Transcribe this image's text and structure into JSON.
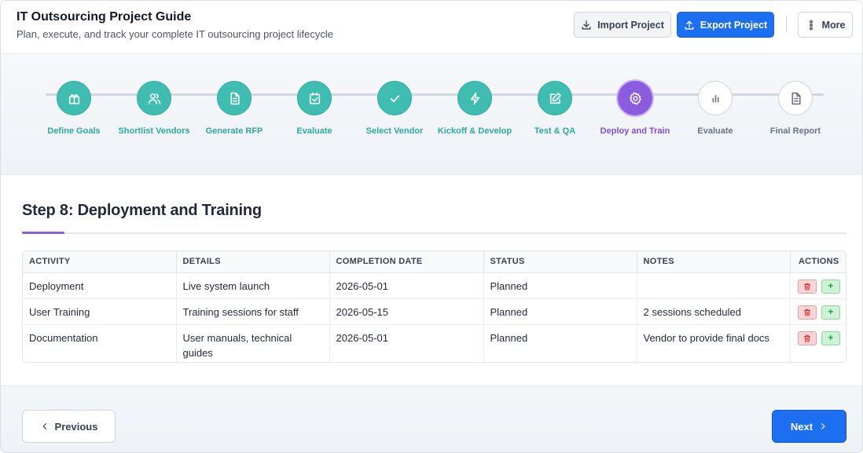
{
  "header": {
    "title": "IT Outsourcing Project Guide",
    "subtitle": "Plan, execute, and track your complete IT outsourcing project lifecycle",
    "import_label": "Import Project",
    "export_label": "Export Project",
    "more_label": "More"
  },
  "stepper": {
    "steps": [
      {
        "label": "Define Goals",
        "state": "done",
        "icon": "gift-icon"
      },
      {
        "label": "Shortlist Vendors",
        "state": "done",
        "icon": "users-icon"
      },
      {
        "label": "Generate RFP",
        "state": "done",
        "icon": "document-icon"
      },
      {
        "label": "Evaluate",
        "state": "done",
        "icon": "clipboard-check-icon"
      },
      {
        "label": "Select Vendor",
        "state": "done",
        "icon": "check-icon"
      },
      {
        "label": "Kickoff & Develop",
        "state": "done",
        "icon": "lightning-icon"
      },
      {
        "label": "Test & QA",
        "state": "done",
        "icon": "edit-icon"
      },
      {
        "label": "Deploy and Train",
        "state": "current",
        "icon": "gear-icon"
      },
      {
        "label": "Evaluate",
        "state": "todo",
        "icon": "bar-chart-icon"
      },
      {
        "label": "Final Report",
        "state": "todo",
        "icon": "report-icon"
      }
    ]
  },
  "main": {
    "title": "Step 8: Deployment and Training",
    "table": {
      "headers": [
        "ACTIVITY",
        "DETAILS",
        "COMPLETION DATE",
        "STATUS",
        "NOTES",
        "ACTIONS"
      ],
      "rows": [
        {
          "activity": "Deployment",
          "details": "Live system launch",
          "date": "2026-05-01",
          "status": "Planned",
          "notes": ""
        },
        {
          "activity": "User Training",
          "details": "Training sessions for staff",
          "date": "2026-05-15",
          "status": "Planned",
          "notes": "2 sessions scheduled"
        },
        {
          "activity": "Documentation",
          "details": "User manuals, technical guides",
          "date": "2026-05-01",
          "status": "Planned",
          "notes": "Vendor to provide final docs"
        }
      ]
    }
  },
  "footer": {
    "prev_label": "Previous",
    "next_label": "Next"
  },
  "colors": {
    "done": "#3fbdb1",
    "current": "#8c5ce0",
    "primary": "#1d6ff2",
    "delete": "#dc2626",
    "add": "#16a34a"
  }
}
